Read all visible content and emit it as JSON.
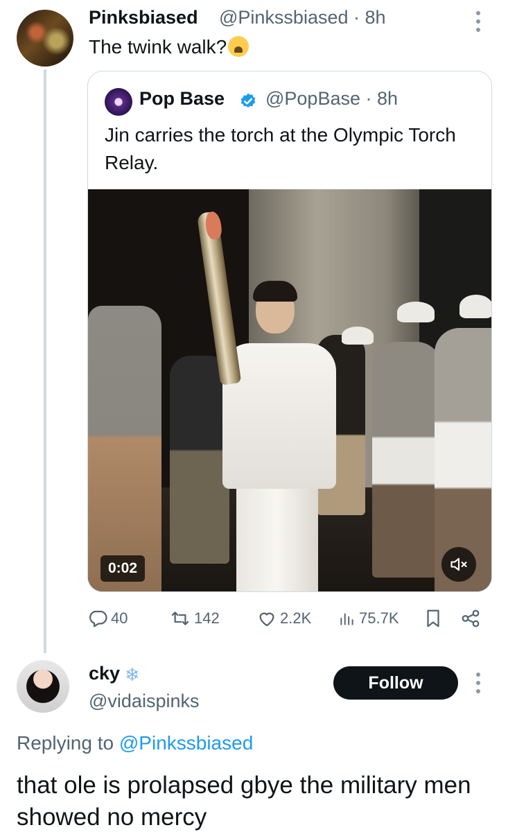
{
  "tweet": {
    "author_name": "Pinksbiased",
    "author_handle": "@Pinkssbiased",
    "time": "8h",
    "text": "The twink walk?",
    "emoji": "loudly-crying-face"
  },
  "quoted_tweet": {
    "author_name": "Pop Base",
    "author_handle": "@PopBase",
    "time": "8h",
    "verified": true,
    "text": "Jin carries the torch at the Olympic Torch Relay.",
    "video_time": "0:02",
    "muted": true
  },
  "metrics": {
    "replies": "40",
    "reposts": "142",
    "likes": "2.2K",
    "views": "75.7K"
  },
  "reply": {
    "author_name": "cky",
    "author_handle": "@vidaispinks",
    "follow_label": "Follow",
    "replying_prefix": "Replying to",
    "replying_mention": "@Pinkssbiased",
    "text": "that ole is prolapsed gbye the military men showed no mercy"
  },
  "colors": {
    "accent": "#1d9bf0",
    "secondary_text": "#536471",
    "border": "#cfd9de",
    "primary_text": "#0f1419"
  }
}
